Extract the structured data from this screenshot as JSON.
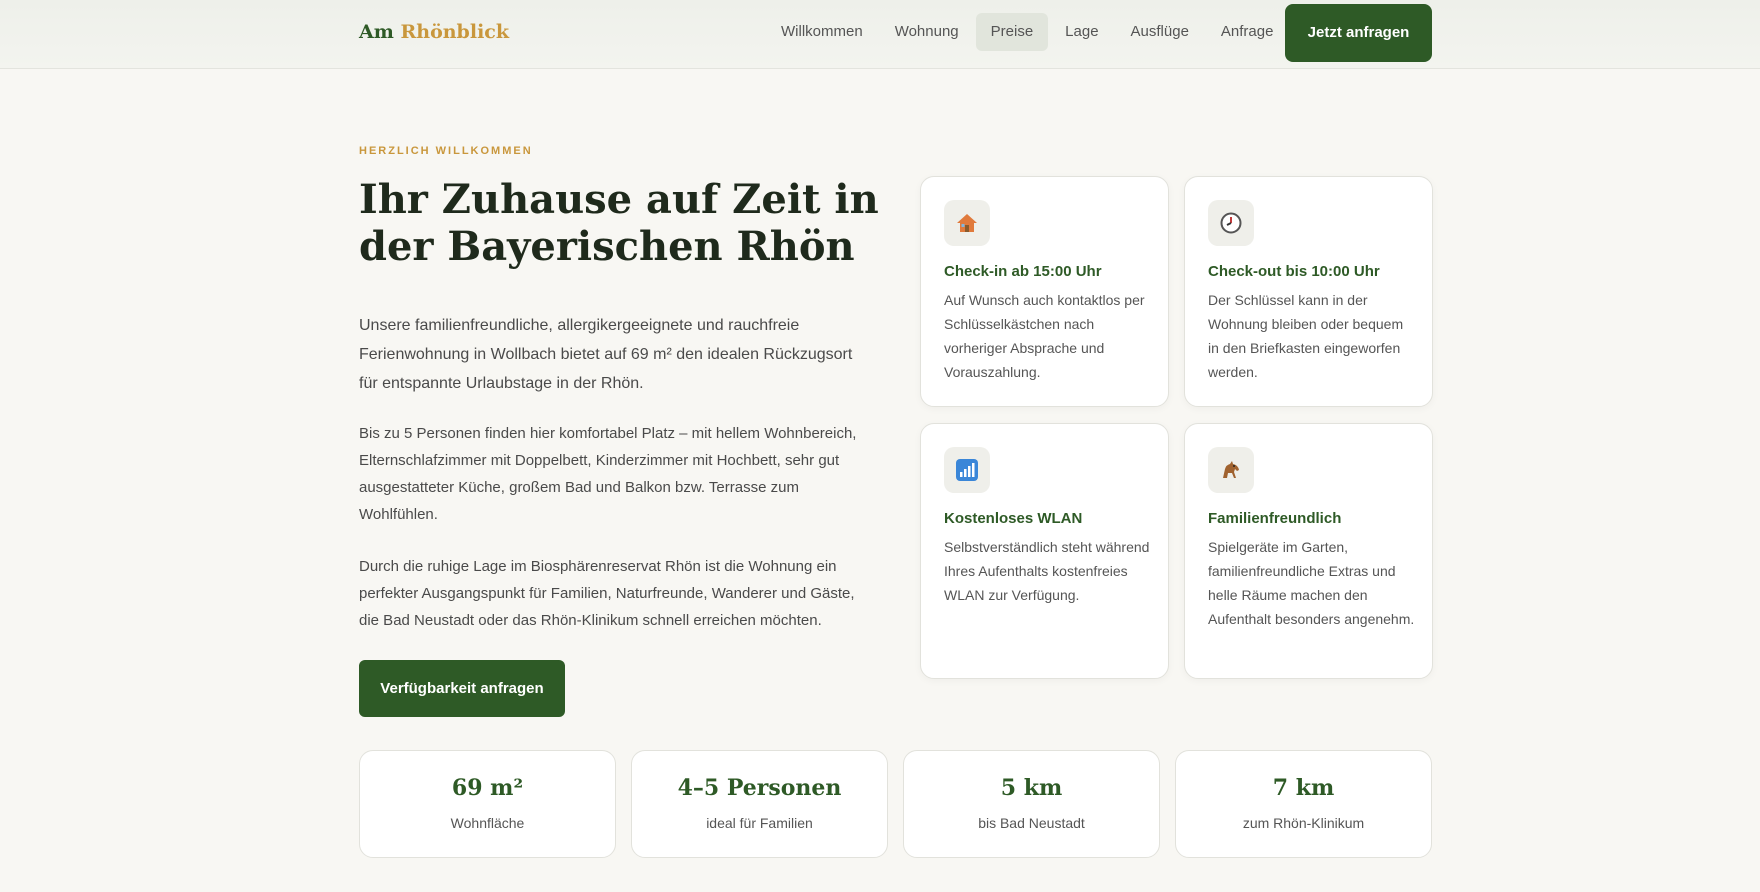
{
  "header": {
    "logo_part1": "Am ",
    "logo_part2": "Rhönblick",
    "nav": [
      "Willkommen",
      "Wohnung",
      "Preise",
      "Lage",
      "Ausflüge",
      "Anfrage"
    ],
    "active_nav": "Preise",
    "cta": "Jetzt anfragen"
  },
  "hero": {
    "eyebrow": "HERZLICH WILLKOMMEN",
    "title": "Ihr Zuhause auf Zeit in der Bayerischen Rhön",
    "p1": "Unsere familienfreundliche, allergikergeeignete und rauchfreie Ferienwohnung in Wollbach bietet auf 69 m² den idealen Rückzugsort für entspannte Urlaubstage in der Rhön.",
    "p2": "Bis zu 5 Personen finden hier komfortabel Platz – mit hellem Wohnbereich, Elternschlafzimmer mit Doppelbett, Kinderzimmer mit Hochbett, sehr gut ausgestatteter Küche, großem Bad und Balkon bzw. Terrasse zum Wohlfühlen.",
    "p3": "Durch die ruhige Lage im Biosphärenreservat Rhön ist die Wohnung ein perfekter Ausgangspunkt für Familien, Naturfreunde, Wanderer und Gäste, die Bad Neustadt oder das Rhön-Klinikum schnell erreichen möchten.",
    "cta": "Verfügbarkeit anfragen"
  },
  "features": [
    {
      "icon": "house-icon",
      "title": "Check-in ab 15:00 Uhr",
      "text": "Auf Wunsch auch kontaktlos per Schlüsselkästchen nach vorheriger Absprache und Vorauszahlung."
    },
    {
      "icon": "clock-icon",
      "title": "Check-out bis 10:00 Uhr",
      "text": "Der Schlüssel kann in der Wohnung bleiben oder bequem in den Briefkasten eingeworfen werden."
    },
    {
      "icon": "signal-icon",
      "title": "Kostenloses WLAN",
      "text": "Selbstverständlich steht während Ihres Aufenthalts kostenfreies WLAN zur Verfügung."
    },
    {
      "icon": "horse-icon",
      "title": "Familienfreundlich",
      "text": "Spielgeräte im Garten, familienfreundliche Extras und helle Räume machen den Aufenthalt besonders angenehm."
    }
  ],
  "stats": [
    {
      "value": "69 m²",
      "label": "Wohnfläche"
    },
    {
      "value": "4–5 Personen",
      "label": "ideal für Familien"
    },
    {
      "value": "5 km",
      "label": "bis Bad Neustadt"
    },
    {
      "value": "7 km",
      "label": "zum Rhön-Klinikum"
    }
  ],
  "colors": {
    "brand_green": "#2e5a26",
    "accent_gold": "#c9973c",
    "background": "#f8f7f3"
  }
}
